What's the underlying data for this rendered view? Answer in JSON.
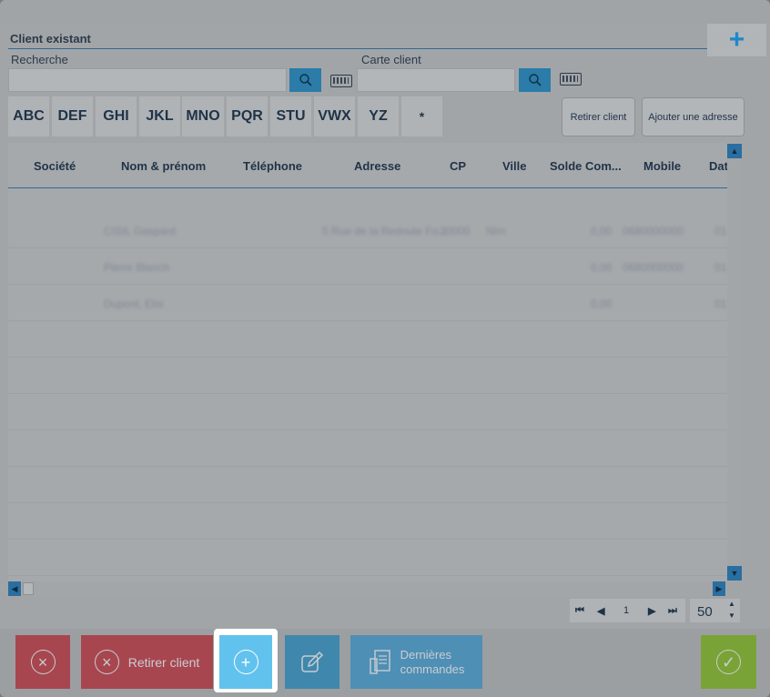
{
  "section": {
    "title": "Client existant"
  },
  "search": {
    "label": "Recherche",
    "value": "",
    "card_label": "Carte client",
    "card_value": ""
  },
  "alphabet": [
    "ABC",
    "DEF",
    "GHI",
    "JKL",
    "MNO",
    "PQR",
    "STU",
    "VWX",
    "YZ",
    "*"
  ],
  "actions": {
    "remove_client": "Retirer client",
    "add_address": "Ajouter une adresse",
    "add_top": "+"
  },
  "table": {
    "columns": [
      "Société",
      "Nom & prénom",
      "Téléphone",
      "Adresse",
      "CP",
      "Ville",
      "Solde Com...",
      "Mobile",
      "Dat"
    ],
    "rows": [
      {
        "nom": "CISIL Gaspard",
        "adresse": "5 Rue de la Redoute Fo...",
        "cp": "30000",
        "ville": "Nîm",
        "solde": "0,00",
        "mobile": "0680000000",
        "date": "01"
      },
      {
        "nom": "Pierre Blanch",
        "adresse": "",
        "cp": "",
        "ville": "",
        "solde": "0,00",
        "mobile": "0680000000",
        "date": "01"
      },
      {
        "nom": "Dupont, Eloi",
        "adresse": "",
        "cp": "",
        "ville": "",
        "solde": "0,00",
        "mobile": "",
        "date": "01"
      }
    ]
  },
  "pager": {
    "first": "⏮",
    "prev": "◀",
    "page": "1",
    "next": "▶",
    "last": "⏭",
    "page_size": "50"
  },
  "bottom": {
    "cancel_icon": "close-icon",
    "remove_label": "Retirer client",
    "add_icon": "plus-icon",
    "edit_icon": "edit-icon",
    "orders_label_1": "Dernières",
    "orders_label_2": "commandes",
    "confirm_icon": "check-icon"
  },
  "colors": {
    "cancel": "#a84650",
    "add": "#62c2ee",
    "edit": "#3f87ad",
    "orders": "#4e8fb5",
    "confirm": "#79a336",
    "accent": "#1e88c8"
  }
}
